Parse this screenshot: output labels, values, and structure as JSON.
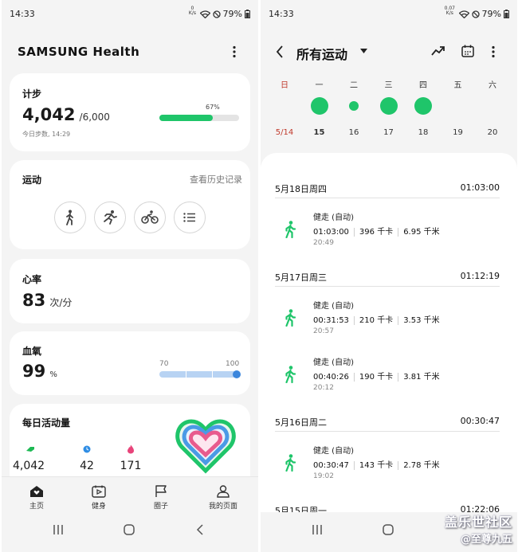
{
  "left": {
    "status": {
      "time": "14:33",
      "net_value": "0",
      "net_unit": "K/s",
      "battery": "79%"
    },
    "app_title": "SAMSUNG Health",
    "steps": {
      "title": "计步",
      "value": "4,042",
      "goal": "/6,000",
      "percent_label": "67%",
      "percent": 67,
      "subtitle": "今日步数, 14:29"
    },
    "exercise": {
      "title": "运动",
      "history_link": "查看历史记录",
      "icons": [
        "walking-icon",
        "running-icon",
        "cycling-icon",
        "list-icon"
      ]
    },
    "heart_rate": {
      "title": "心率",
      "value": "83",
      "unit": "次/分"
    },
    "blood_oxygen": {
      "title": "血氧",
      "value": "99",
      "unit": "%",
      "range_min": "70",
      "range_max": "100",
      "level": 99
    },
    "daily_activity": {
      "title": "每日活动量",
      "stats": [
        {
          "icon": "steps-icon",
          "value": "4,042",
          "color": "#1db954"
        },
        {
          "icon": "clock-icon",
          "value": "42",
          "color": "#2f8de4"
        },
        {
          "icon": "flame-icon",
          "value": "171",
          "color": "#e8447a"
        }
      ]
    },
    "tabs": [
      {
        "label": "主页",
        "icon": "home-icon"
      },
      {
        "label": "健身",
        "icon": "fitness-icon"
      },
      {
        "label": "圈子",
        "icon": "flag-icon"
      },
      {
        "label": "我的页面",
        "icon": "profile-icon"
      }
    ]
  },
  "right": {
    "status": {
      "time": "14:33",
      "net_value": "0.07",
      "net_unit": "K/s",
      "battery": "79%"
    },
    "header_title": "所有运动",
    "weekdays": [
      "日",
      "一",
      "二",
      "三",
      "四",
      "五",
      "六"
    ],
    "dates": [
      "5/14",
      "15",
      "16",
      "17",
      "18",
      "19",
      "20"
    ],
    "activity_dot_sizes": [
      0,
      2,
      1,
      2,
      2,
      0,
      0
    ],
    "groups": [
      {
        "date": "5月18日周四",
        "total": "01:03:00",
        "items": [
          {
            "name": "健走 (自动)",
            "duration": "01:03:00",
            "calories": "396 千卡",
            "distance": "6.95 千米",
            "time": "20:49"
          }
        ]
      },
      {
        "date": "5月17日周三",
        "total": "01:12:19",
        "items": [
          {
            "name": "健走 (自动)",
            "duration": "00:31:53",
            "calories": "210 千卡",
            "distance": "3.53 千米",
            "time": "20:57"
          },
          {
            "name": "健走 (自动)",
            "duration": "00:40:26",
            "calories": "190 千卡",
            "distance": "3.81 千米",
            "time": "20:12"
          }
        ]
      },
      {
        "date": "5月16日周二",
        "total": "00:30:47",
        "items": [
          {
            "name": "健走 (自动)",
            "duration": "00:30:47",
            "calories": "143 千卡",
            "distance": "2.78 千米",
            "time": "19:02"
          }
        ]
      },
      {
        "date": "5月15日周一",
        "total": "01:22:06",
        "items": []
      }
    ],
    "watermark": {
      "line1": "盖乐世社区",
      "line2": "@至尊九五"
    }
  }
}
